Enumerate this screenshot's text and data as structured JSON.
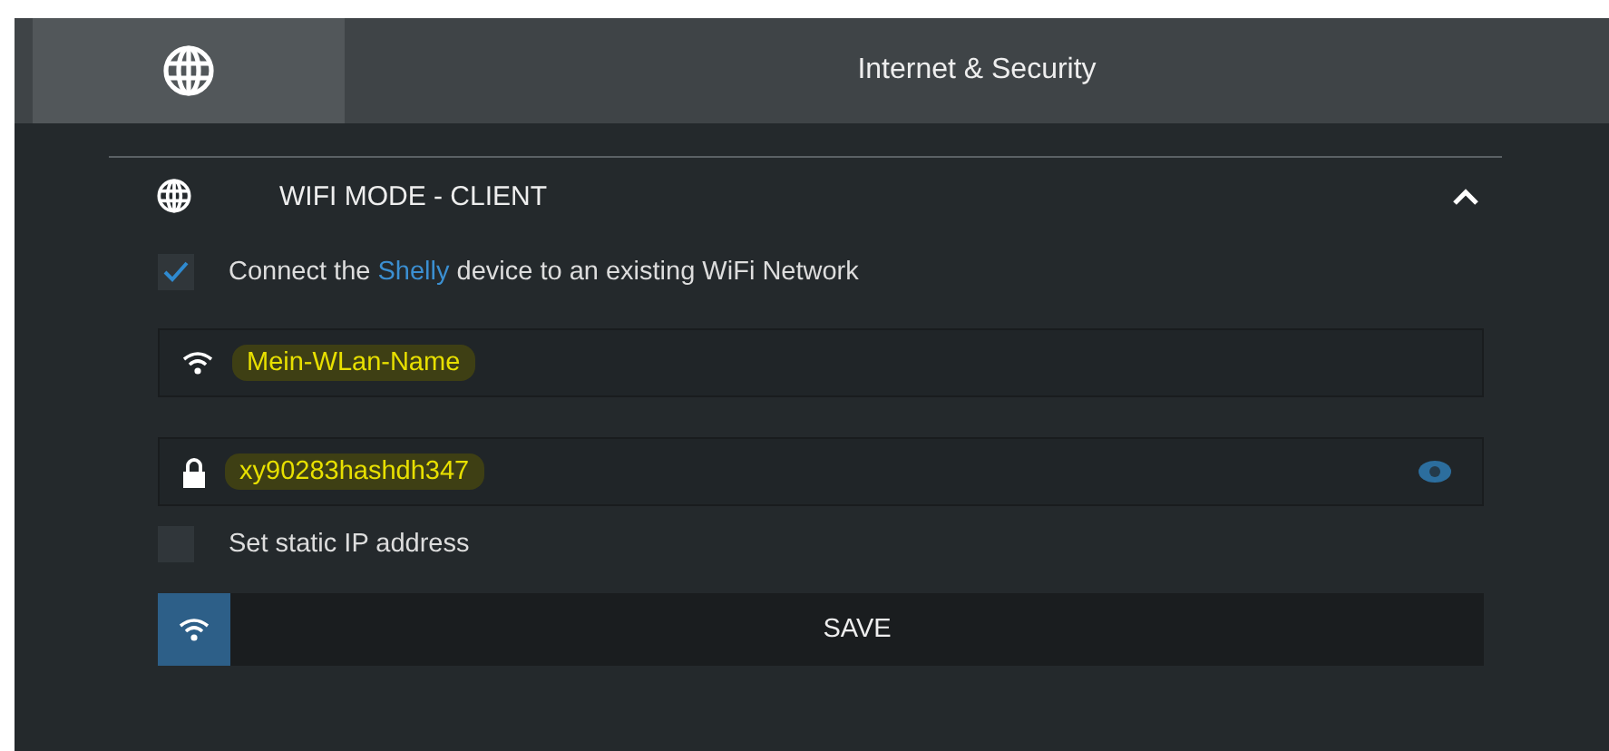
{
  "header": {
    "tabs": [
      {
        "kind": "icon",
        "selected": true
      },
      {
        "kind": "text",
        "label": "Internet & Security",
        "selected": false
      }
    ]
  },
  "section": {
    "title": "WIFI MODE - CLIENT",
    "expanded": true,
    "connect": {
      "checked": true,
      "before": "Connect the",
      "link": "Shelly",
      "after": "device to an existing WiFi Network"
    },
    "ssid": {
      "value": "Mein-WLan-Name"
    },
    "password": {
      "value": "xy90283hashdh347"
    },
    "static_ip": {
      "checked": false,
      "label": "Set static IP address"
    },
    "save": {
      "label": "SAVE"
    }
  }
}
